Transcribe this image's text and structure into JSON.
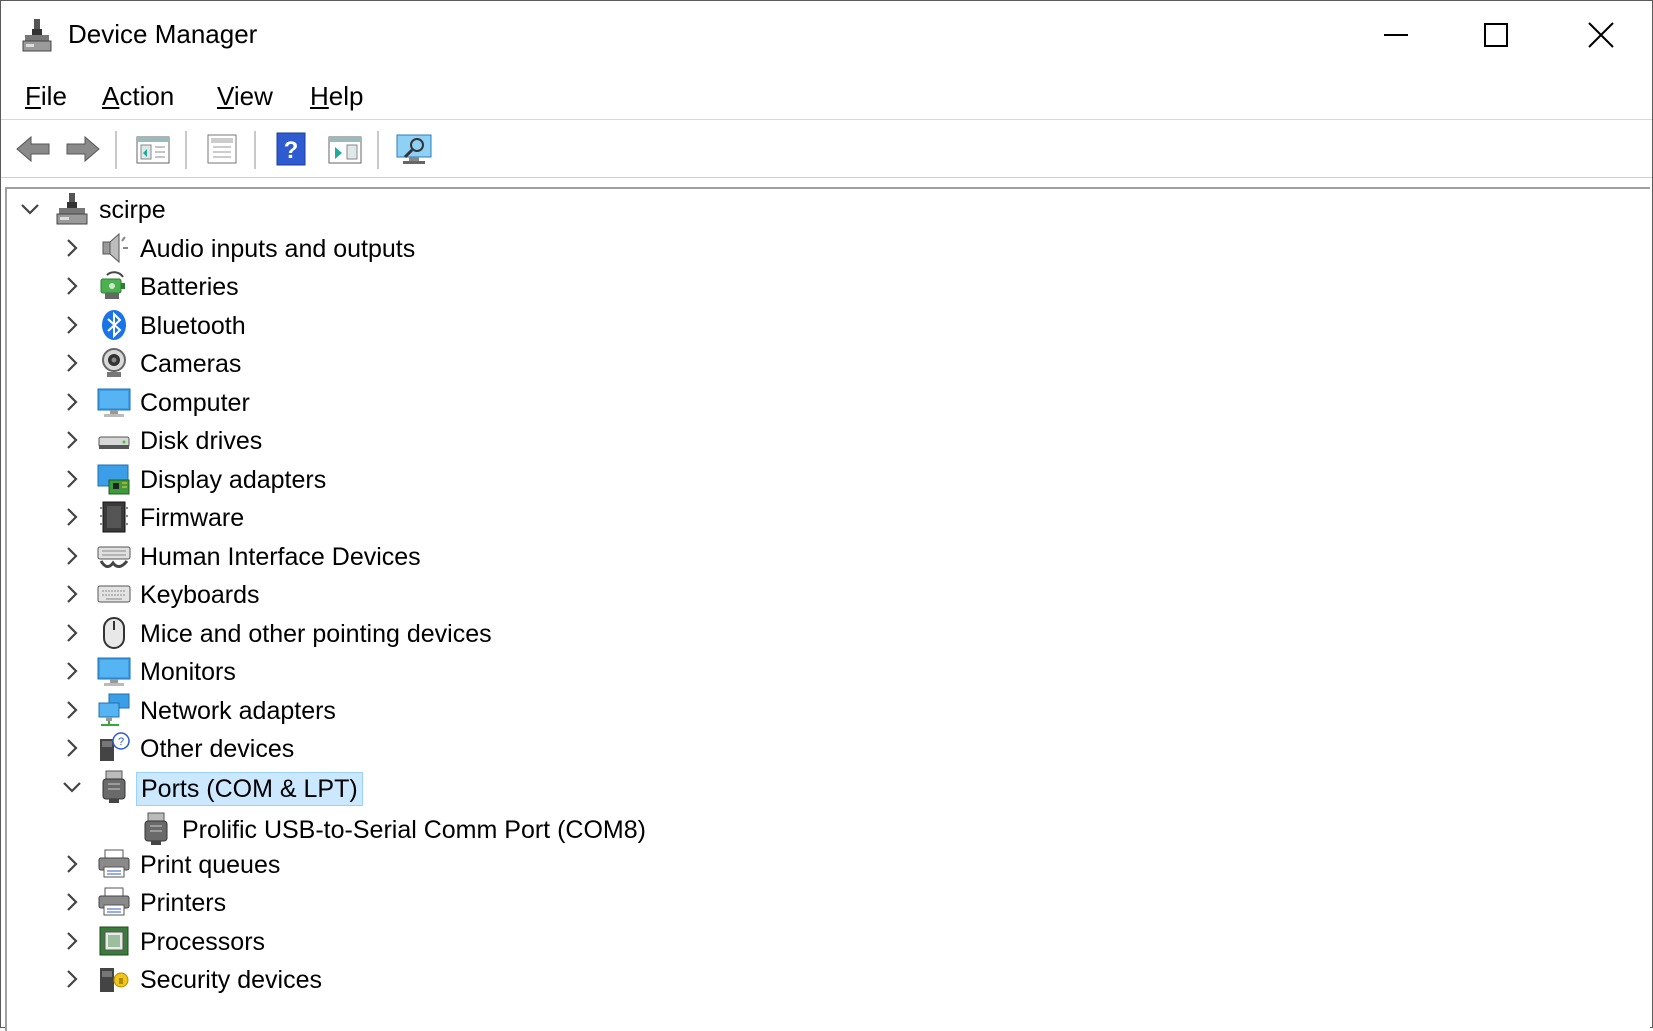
{
  "window": {
    "title": "Device Manager"
  },
  "menu": [
    {
      "label": "File",
      "accel": "F",
      "rest": "ile"
    },
    {
      "label": "Action",
      "accel": "A",
      "rest": "ction"
    },
    {
      "label": "View",
      "accel": "V",
      "rest": "iew"
    },
    {
      "label": "Help",
      "accel": "H",
      "rest": "elp"
    }
  ],
  "tree": {
    "root": {
      "label": "scirpe",
      "icon": "computer-tower-icon",
      "expanded": true
    },
    "categories": [
      {
        "label": "Audio inputs and outputs",
        "icon": "speaker-icon",
        "expanded": false
      },
      {
        "label": "Batteries",
        "icon": "battery-icon",
        "expanded": false
      },
      {
        "label": "Bluetooth",
        "icon": "bluetooth-icon",
        "expanded": false
      },
      {
        "label": "Cameras",
        "icon": "camera-icon",
        "expanded": false
      },
      {
        "label": "Computer",
        "icon": "monitor-icon",
        "expanded": false
      },
      {
        "label": "Disk drives",
        "icon": "disk-drive-icon",
        "expanded": false
      },
      {
        "label": "Display adapters",
        "icon": "display-adapter-icon",
        "expanded": false
      },
      {
        "label": "Firmware",
        "icon": "firmware-chip-icon",
        "expanded": false
      },
      {
        "label": "Human Interface Devices",
        "icon": "hid-icon",
        "expanded": false
      },
      {
        "label": "Keyboards",
        "icon": "keyboard-icon",
        "expanded": false
      },
      {
        "label": "Mice and other pointing devices",
        "icon": "mouse-icon",
        "expanded": false
      },
      {
        "label": "Monitors",
        "icon": "monitor-icon",
        "expanded": false
      },
      {
        "label": "Network adapters",
        "icon": "network-icon",
        "expanded": false
      },
      {
        "label": "Other devices",
        "icon": "unknown-device-icon",
        "expanded": false
      },
      {
        "label": "Ports (COM & LPT)",
        "icon": "port-icon",
        "expanded": true,
        "selected": true,
        "children": [
          {
            "label": "Prolific USB-to-Serial Comm Port (COM8)",
            "icon": "port-icon"
          }
        ]
      },
      {
        "label": "Print queues",
        "icon": "printer-icon",
        "expanded": false
      },
      {
        "label": "Printers",
        "icon": "printer-icon",
        "expanded": false
      },
      {
        "label": "Processors",
        "icon": "processor-icon",
        "expanded": false
      },
      {
        "label": "Security devices",
        "icon": "security-device-icon",
        "expanded": false
      }
    ]
  },
  "colors": {
    "selection": "#cce8ff",
    "selection_border": "#99d1ff",
    "monitor": "#3c9ee8",
    "bluetooth": "#1a73e8"
  }
}
